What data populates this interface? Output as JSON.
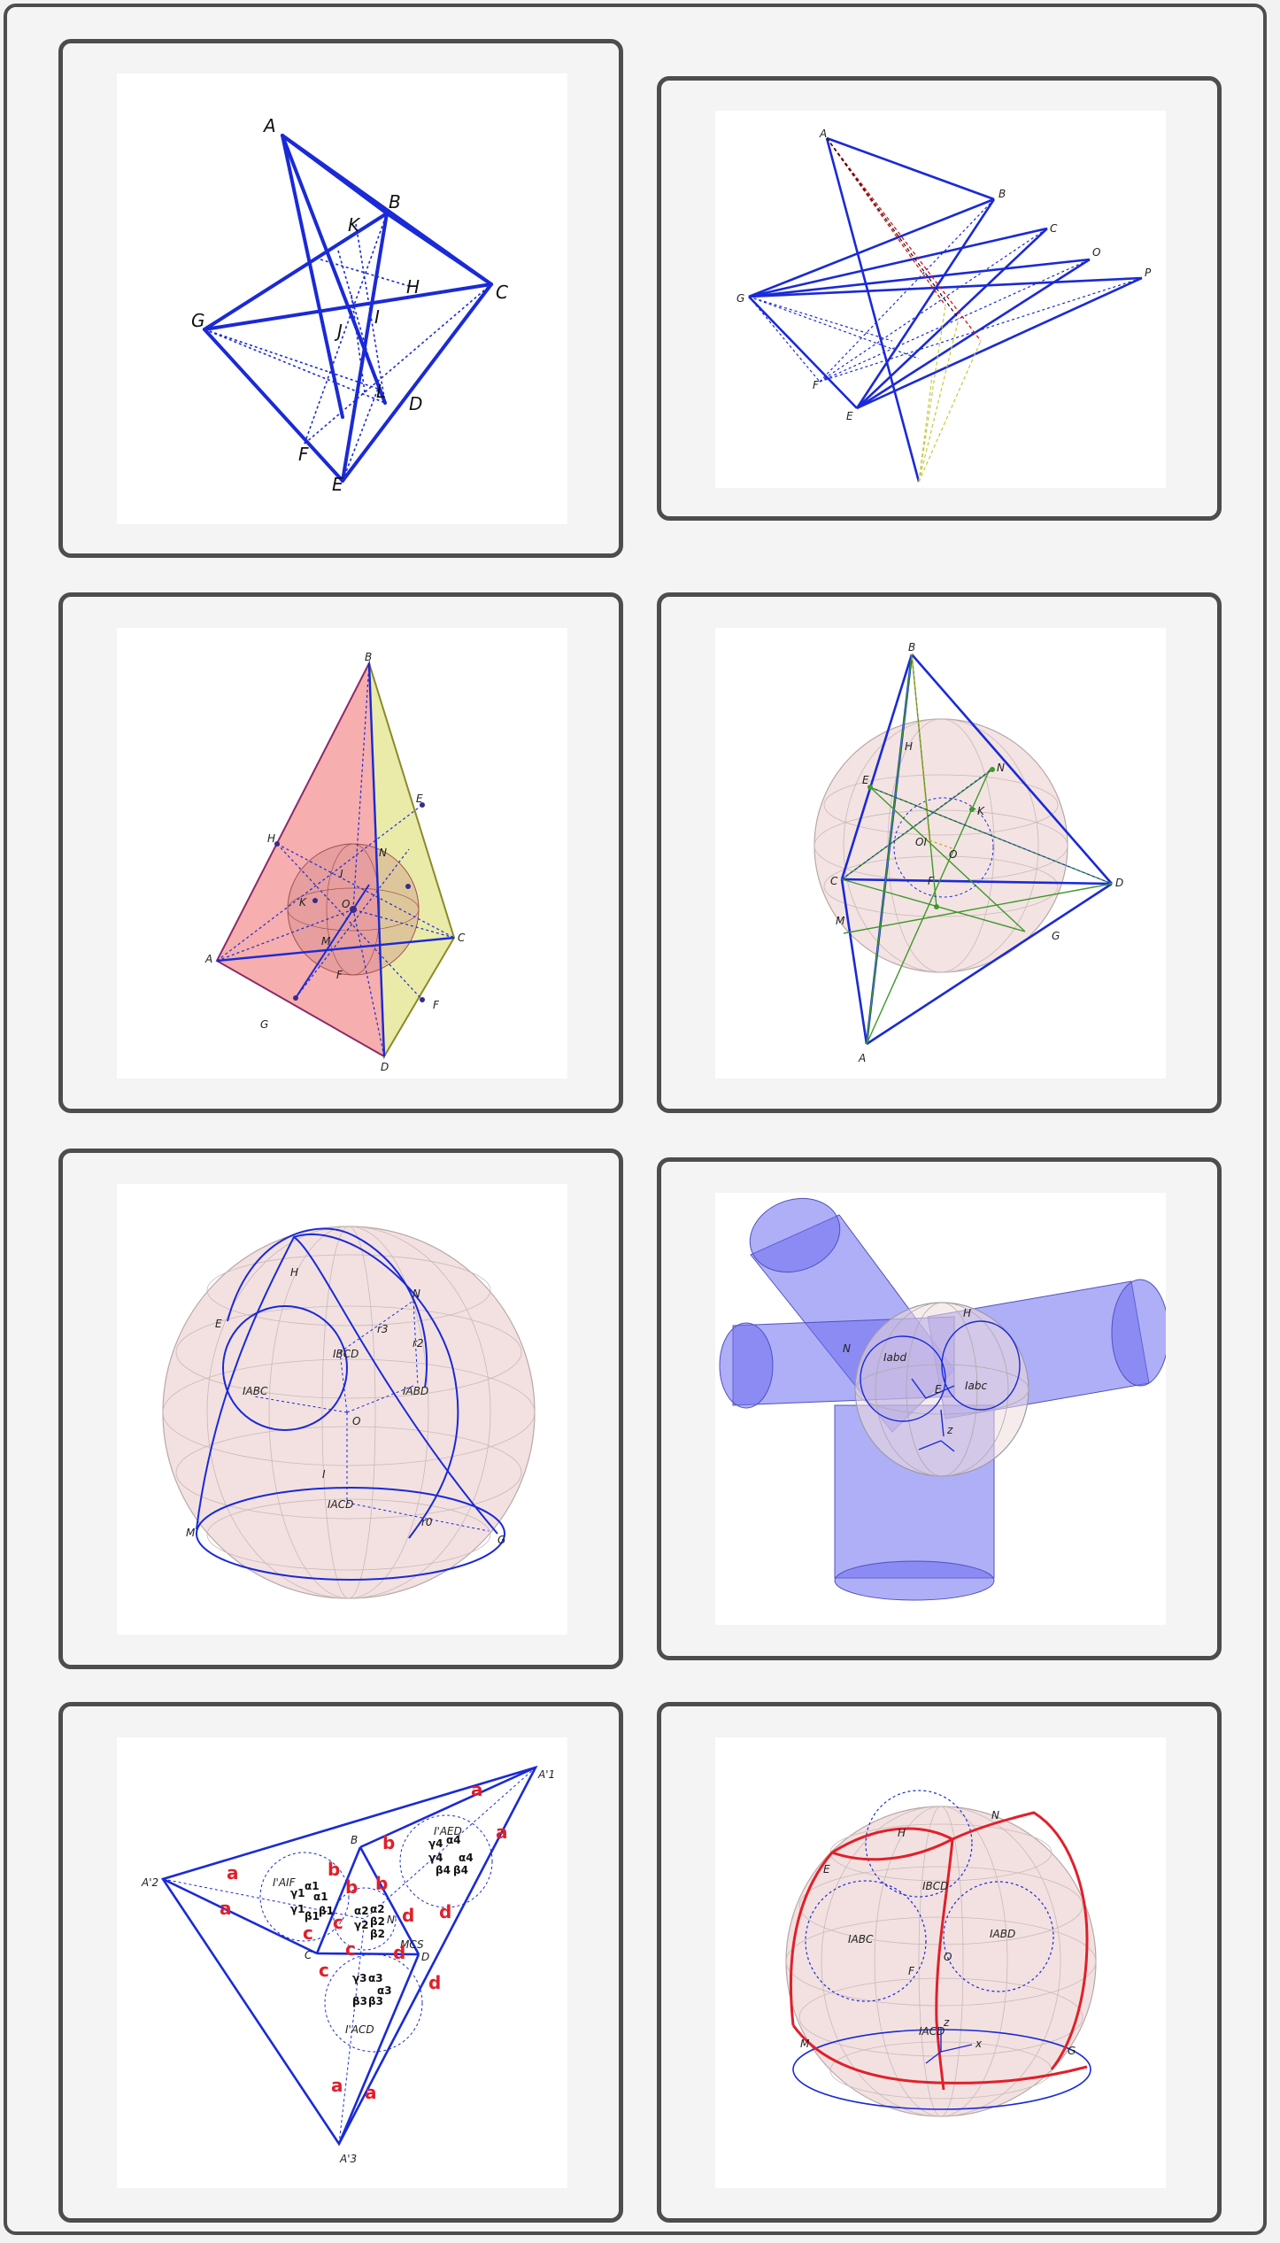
{
  "accent_colors": {
    "edge": "#1a2ad6",
    "dotted_red": "#e01818",
    "dotted_yellow": "#c8c83a",
    "face_pink": "#f4a0a0",
    "face_yellow": "#e6e79a",
    "sphere": "#f1dcdc",
    "cylinder": "#6e6ef0",
    "great_circle_red": "#e0202a",
    "green_lines": "#3c9a28"
  },
  "panels": [
    {
      "id": "panel-1",
      "labels": {
        "A": "A",
        "B": "B",
        "C": "C",
        "D": "D",
        "E": "E",
        "F": "F",
        "G": "G",
        "H": "H",
        "I": "I",
        "J": "J",
        "K": "K",
        "L": "L"
      }
    },
    {
      "id": "panel-2",
      "labels": {
        "A": "A",
        "B": "B",
        "C": "C",
        "O": "O",
        "P": "P",
        "G": "G",
        "F": "F",
        "E": "E"
      }
    },
    {
      "id": "panel-3",
      "labels": {
        "B": "B",
        "E": "E",
        "H": "H",
        "N": "N",
        "I": "I",
        "K": "K",
        "O": "O",
        "M": "M",
        "A": "A",
        "C": "C",
        "F": "F",
        "G": "G",
        "D": "D",
        "P": "F"
      }
    },
    {
      "id": "panel-4",
      "labels": {
        "B": "B",
        "H": "H",
        "N": "N",
        "E": "E",
        "K": "K",
        "O": "O",
        "OI": "OI",
        "C": "C",
        "D": "D",
        "M": "M",
        "G": "G",
        "F": "F",
        "A": "A"
      }
    },
    {
      "id": "panel-5",
      "labels": {
        "H": "H",
        "N": "N",
        "E": "E",
        "r3": "r3",
        "r2": "r2",
        "IBCD": "IBCD",
        "IABC": "IABC",
        "IABD": "IABD",
        "O": "O",
        "I": "I",
        "IACD": "IACD",
        "M": "M",
        "r0": "r0",
        "G": "G"
      }
    },
    {
      "id": "panel-6",
      "labels": {
        "H": "H",
        "N": "N",
        "Iabd": "Iabd",
        "E": "E",
        "Iabc": "Iabc",
        "z": "z"
      }
    },
    {
      "id": "panel-7",
      "labels": {
        "A1": "A'1",
        "A2": "A'2",
        "A3": "A'3",
        "B": "B",
        "C": "C",
        "D": "D",
        "N": "N",
        "IAED": "I'AED",
        "IAIF": "I'AIF",
        "IACD": "I'ACD",
        "MCS": "MCS",
        "a": "a",
        "b": "b",
        "c": "c",
        "d": "d",
        "alpha1": "α1",
        "alpha2": "α2",
        "alpha3": "α3",
        "alpha4": "α4",
        "beta1": "β1",
        "beta2": "β2",
        "beta3": "β3",
        "beta4": "β4",
        "gamma1": "γ1",
        "gamma2": "γ2",
        "gamma3": "γ3",
        "gamma4": "γ4"
      }
    },
    {
      "id": "panel-8",
      "labels": {
        "H": "H",
        "N": "N",
        "E": "E",
        "IBCD": "IBCD",
        "IABC": "IABC",
        "IABD": "IABD",
        "O": "O",
        "F": "F",
        "IACD": "IACD",
        "M": "M",
        "G": "G",
        "z": "z",
        "x": "x"
      }
    }
  ]
}
